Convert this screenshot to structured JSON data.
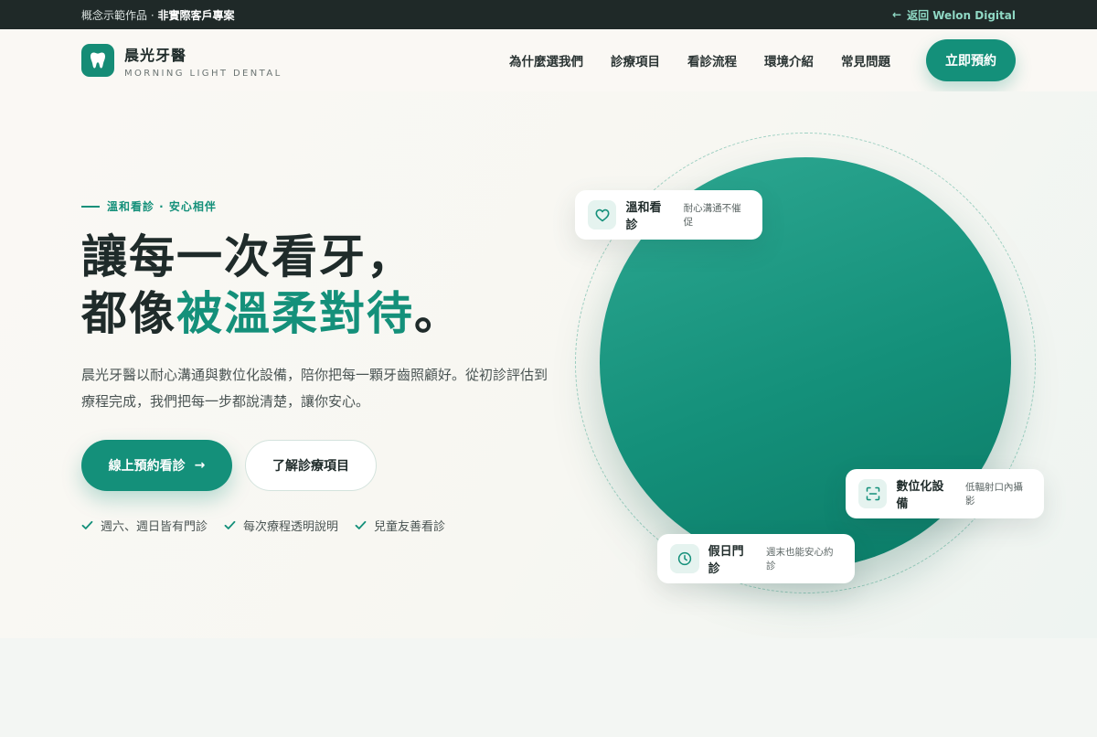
{
  "topbar": {
    "notice_prefix": "概念示範作品 · ",
    "notice_strong": "非實際客戶專案",
    "back_arrow": "←",
    "back_label": "返回 Welon Digital"
  },
  "brand": {
    "name": "晨光牙醫",
    "sub": "MORNING LIGHT DENTAL",
    "logo_icon": "tooth-icon",
    "accent_color": "#14907a"
  },
  "nav": {
    "items": [
      {
        "label": "為什麼選我們"
      },
      {
        "label": "診療項目"
      },
      {
        "label": "看診流程"
      },
      {
        "label": "環境介紹"
      },
      {
        "label": "常見問題"
      }
    ],
    "book_label": "立即預約"
  },
  "hero": {
    "eyebrow": "溫和看診 · 安心相伴",
    "headline_line1": "讓每一次看牙，",
    "headline_line2_prefix": "都像",
    "headline_line2_accent": "被溫柔對待",
    "headline_line2_suffix": "。",
    "lead": "晨光牙醫以耐心溝通與數位化設備，陪你把每一顆牙齒照顧好。從初診評估到療程完成，我們把每一步都說清楚，讓你安心。",
    "cta_primary": "線上預約看診",
    "cta_primary_arrow": "→",
    "cta_secondary": "了解診療項目",
    "checks": [
      {
        "label": "週六、週日皆有門診"
      },
      {
        "label": "每次療程透明說明"
      },
      {
        "label": "兒童友善看診"
      }
    ]
  },
  "cards": {
    "gentle": {
      "title": "溫和看診",
      "desc": "耐心溝通不催促",
      "icon": "heart-icon"
    },
    "digital": {
      "title": "數位化設備",
      "desc": "低輻射口內攝影",
      "icon": "scan-icon"
    },
    "holiday": {
      "title": "假日門診",
      "desc": "週末也能安心約診",
      "icon": "clock-icon"
    }
  }
}
